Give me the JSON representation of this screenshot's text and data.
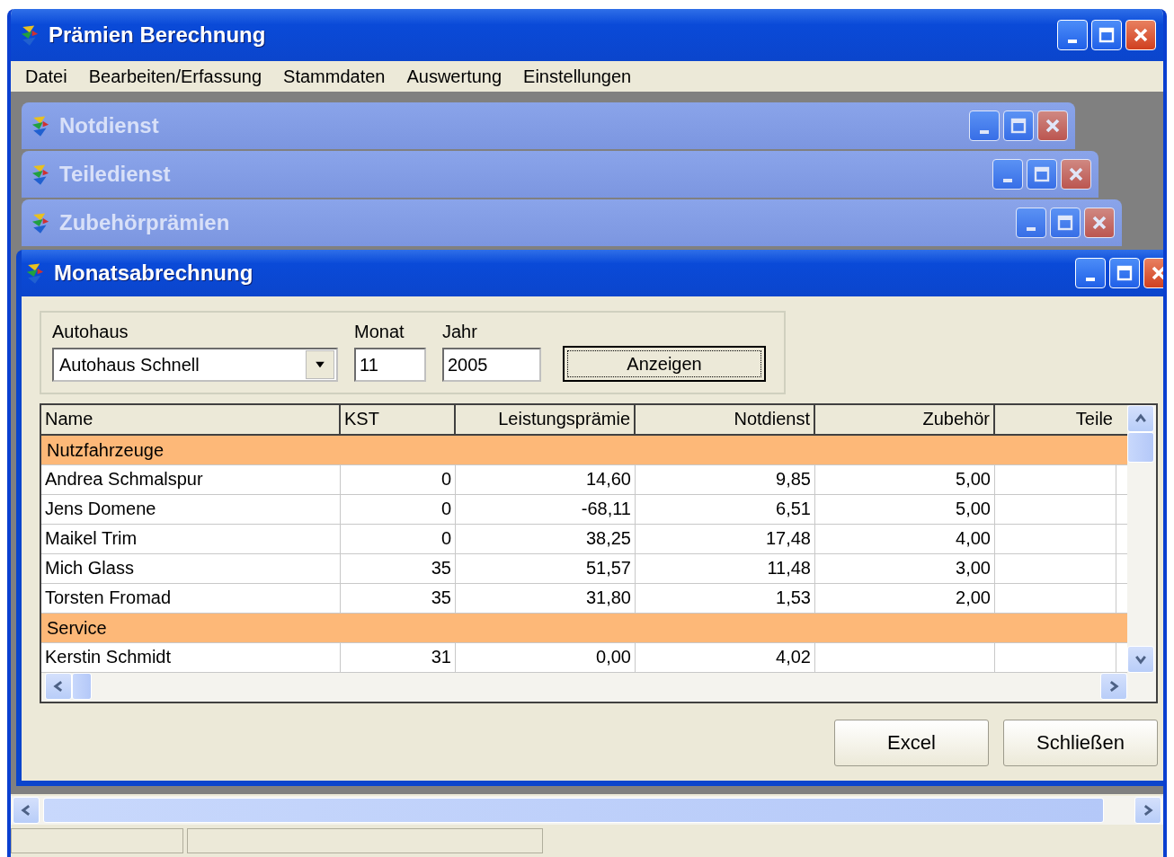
{
  "window": {
    "title": "Prämien Berechnung"
  },
  "menu": [
    "Datei",
    "Bearbeiten/Erfassung",
    "Stammdaten",
    "Auswertung",
    "Einstellungen"
  ],
  "child_windows": [
    {
      "title": "Notdienst",
      "active": false
    },
    {
      "title": "Teiledienst",
      "active": false
    },
    {
      "title": "Zubehörprämien",
      "active": false
    },
    {
      "title": "Monatsabrechnung",
      "active": true
    }
  ],
  "filter": {
    "autohaus": {
      "label": "Autohaus",
      "value": "Autohaus Schnell"
    },
    "monat": {
      "label": "Monat",
      "value": "11"
    },
    "jahr": {
      "label": "Jahr",
      "value": "2005"
    },
    "show_button": "Anzeigen"
  },
  "table": {
    "columns": [
      "Name",
      "KST",
      "Leistungsprämie",
      "Notdienst",
      "Zubehör",
      "Teile"
    ],
    "rows": [
      {
        "kind": "group",
        "name": "Nutzfahrzeuge"
      },
      {
        "kind": "person",
        "cells": [
          "Andrea Schmalspur",
          "0",
          "14,60",
          "9,85",
          "5,00"
        ]
      },
      {
        "kind": "person",
        "cells": [
          "Jens Domene",
          "0",
          "-68,11",
          "6,51",
          "5,00"
        ]
      },
      {
        "kind": "person",
        "cells": [
          "Maikel Trim",
          "0",
          "38,25",
          "17,48",
          "4,00"
        ]
      },
      {
        "kind": "person",
        "cells": [
          "Mich Glass",
          "35",
          "51,57",
          "11,48",
          "3,00"
        ]
      },
      {
        "kind": "person",
        "cells": [
          "Torsten Fromad",
          "35",
          "31,80",
          "1,53",
          "2,00"
        ]
      },
      {
        "kind": "group",
        "name": "Service"
      },
      {
        "kind": "person",
        "cells": [
          "Kerstin Schmidt",
          "31",
          "0,00",
          "4,02"
        ]
      }
    ]
  },
  "buttons": [
    "Excel",
    "Schließen"
  ]
}
